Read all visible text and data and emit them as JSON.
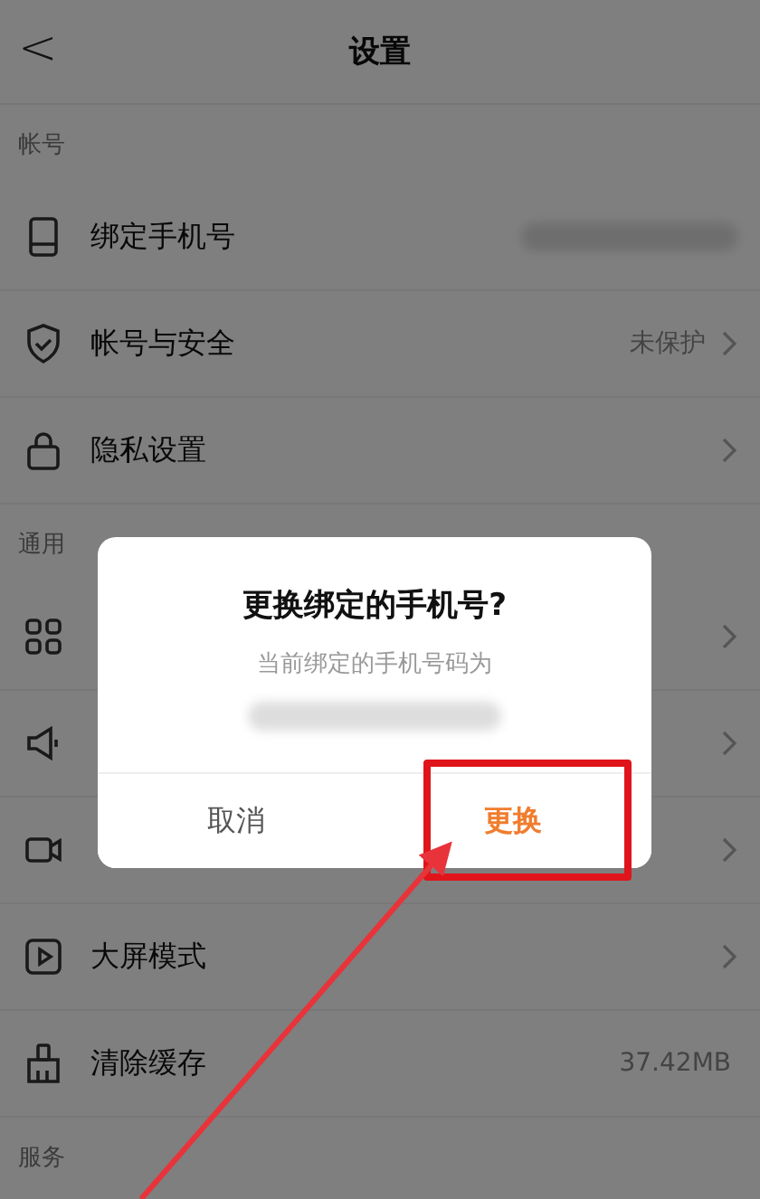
{
  "header": {
    "back": "<",
    "title": "设置"
  },
  "sections": [
    {
      "label": "帐号",
      "rows": [
        {
          "label": "绑定手机号",
          "value_blurred": true,
          "chevron": false
        },
        {
          "label": "帐号与安全",
          "value": "未保护",
          "chevron": true
        },
        {
          "label": "隐私设置",
          "chevron": true
        }
      ]
    },
    {
      "label": "通用",
      "rows": [
        {
          "chevron": true
        },
        {
          "chevron": true
        },
        {
          "chevron": true
        },
        {
          "label": "大屏模式",
          "chevron": true
        },
        {
          "label": "清除缓存",
          "value": "37.42MB",
          "chevron": false
        }
      ]
    },
    {
      "label": "服务"
    }
  ],
  "dialog": {
    "title": "更换绑定的手机号?",
    "message": "当前绑定的手机号码为",
    "number_blurred": true,
    "buttons": [
      {
        "label": "取消",
        "kind": "cancel"
      },
      {
        "label": "更换",
        "kind": "confirm"
      }
    ]
  },
  "annotation": {
    "kind": "arrow-and-box"
  }
}
